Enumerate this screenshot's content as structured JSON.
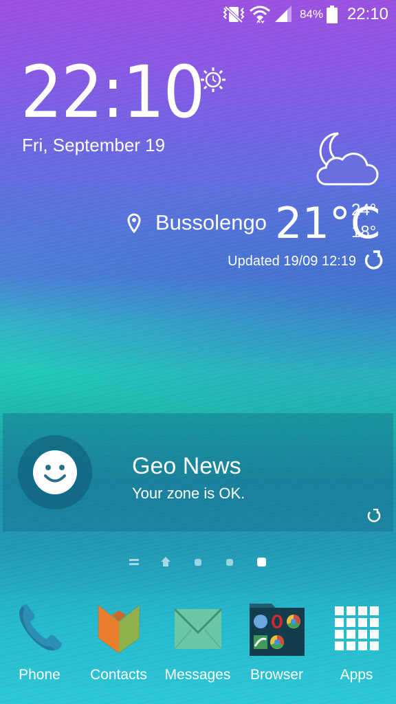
{
  "status_bar": {
    "battery_percent": "84%",
    "time": "22:10",
    "icons": [
      "vibrate-icon",
      "wifi-icon",
      "signal-icon",
      "battery-icon"
    ]
  },
  "lock_clock": {
    "time": "22:10",
    "date": "Fri, September 19",
    "icon": "sun-alarm-icon"
  },
  "weather": {
    "location": "Bussolengo",
    "temperature": "21°C",
    "high": "24°",
    "low": "18°",
    "updated": "Updated 19/09 12:19",
    "icon": "moon-cloud-icon"
  },
  "geo_news": {
    "title": "Geo News",
    "subtitle": "Your zone is OK."
  },
  "pager": {
    "pages": 5,
    "current": 5
  },
  "dock": {
    "items": [
      {
        "label": "Phone",
        "icon": "phone-icon"
      },
      {
        "label": "Contacts",
        "icon": "contacts-icon"
      },
      {
        "label": "Messages",
        "icon": "messages-icon"
      },
      {
        "label": "Browser",
        "icon": "browser-folder-icon"
      },
      {
        "label": "Apps",
        "icon": "apps-grid-icon"
      }
    ]
  },
  "colors": {
    "phone": "#2b8fb6",
    "contacts_left": "#e97f2d",
    "contacts_right": "#8fb04c",
    "messages": "#6bc7a5"
  }
}
